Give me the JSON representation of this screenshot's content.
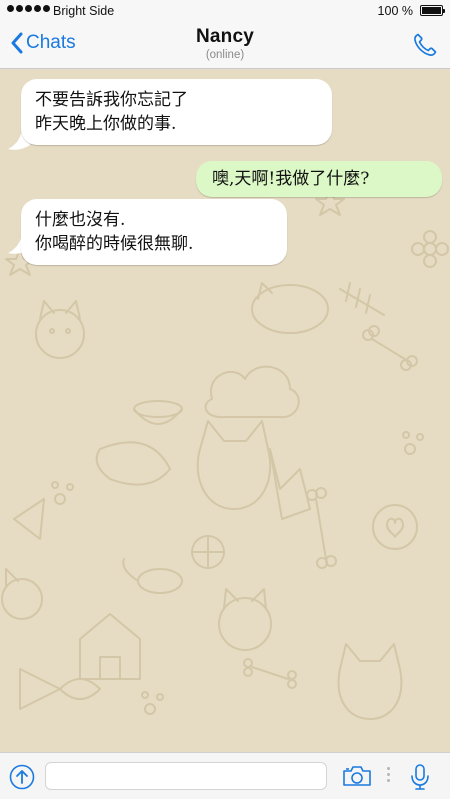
{
  "status_bar": {
    "carrier": "Bright Side",
    "battery_percent": "100 %",
    "battery_level": 1.0
  },
  "nav": {
    "back_label": "Chats",
    "contact_name": "Nancy",
    "contact_status": "(online)"
  },
  "messages": [
    {
      "direction": "incoming",
      "lines": [
        "不要告訴我你忘記了",
        "昨天晚上你做的事."
      ]
    },
    {
      "direction": "outgoing",
      "lines": [
        "噢,天啊!我做了什麼?"
      ]
    },
    {
      "direction": "incoming",
      "lines": [
        "什麼也沒有.",
        "你喝醉的時候很無聊."
      ]
    }
  ],
  "input": {
    "placeholder": ""
  },
  "colors": {
    "accent": "#1a7ae0",
    "incoming_bubble": "#ffffff",
    "outgoing_bubble": "#dcf8c6",
    "wallpaper": "#e6dcc3"
  }
}
